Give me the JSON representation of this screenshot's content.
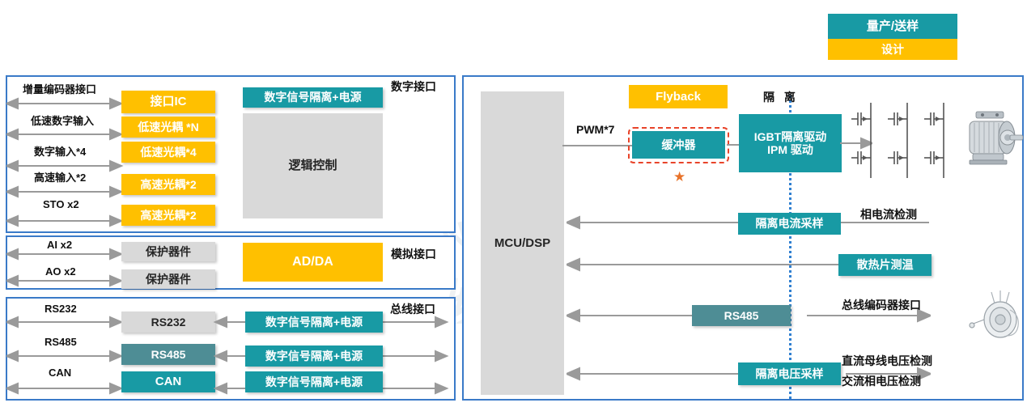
{
  "legend": {
    "items": [
      {
        "label": "量产/送样",
        "color": "#189AA4"
      },
      {
        "label": "设计",
        "color": "#FFC000"
      }
    ]
  },
  "left_panels": {
    "digital": {
      "section_label": "数字接口",
      "signals": [
        {
          "label": "增量编码器接口",
          "block": "接口IC",
          "style": "amber"
        },
        {
          "label": "低速数字输入",
          "block": "低速光耦 *N",
          "style": "amber"
        },
        {
          "label": "数字输入*4",
          "block": "低速光耦*4",
          "style": "amber"
        },
        {
          "label": "高速输入*2",
          "block": "高速光耦*2",
          "style": "amber"
        },
        {
          "label": "STO x2",
          "block": "高速光耦*2",
          "style": "amber"
        }
      ],
      "isolation_block": "数字信号隔离+电源",
      "logic_block": "逻辑控制"
    },
    "analog": {
      "section_label": "模拟接口",
      "signals": [
        {
          "label": "AI x2",
          "block": "保护器件",
          "style": "gray"
        },
        {
          "label": "AO x2",
          "block": "保护器件",
          "style": "gray"
        }
      ],
      "converter_block": "AD/DA"
    },
    "bus": {
      "section_label": "总线接口",
      "rows": [
        {
          "label": "RS232",
          "block": "RS232",
          "style": "gray",
          "isolator": "数字信号隔离+电源"
        },
        {
          "label": "RS485",
          "block": "RS485",
          "style": "teal2",
          "isolator": "数字信号隔离+电源"
        },
        {
          "label": "CAN",
          "block": "CAN",
          "style": "teal",
          "isolator": "数字信号隔离+电源"
        }
      ]
    }
  },
  "right_panel": {
    "mcu_block": "MCU/DSP",
    "pwm_label": "PWM*7",
    "flyback_block": "Flyback",
    "buffer_block": "缓冲器",
    "isolation_label": "隔 离",
    "igbt_block": "IGBT隔离驱动\nIPM 驱动",
    "igbt_block_line1": "IGBT隔离驱动",
    "igbt_block_line2": "IPM 驱动",
    "current_sample_block": "隔离电流采样",
    "current_sample_label": "相电流检测",
    "heatsink_block": "散热片测温",
    "rs485_block": "RS485",
    "encoder_label": "总线编码器接口",
    "voltage_sample_block": "隔离电压采样",
    "voltage_label_1": "直流母线电压检测",
    "voltage_label_2": "交流相电压检测"
  },
  "watermark": {
    "line1": "NOVOSENSE",
    "line2": "纳芯微电子"
  },
  "colors": {
    "teal": "#189AA4",
    "teal_muted": "#4E8D95",
    "amber": "#FFC000",
    "gray": "#D9D9D9",
    "panel_border": "#3A7AC8",
    "highlight": "#E8442A",
    "star": "#E8732A",
    "isolation_line": "#2F7FD0"
  }
}
